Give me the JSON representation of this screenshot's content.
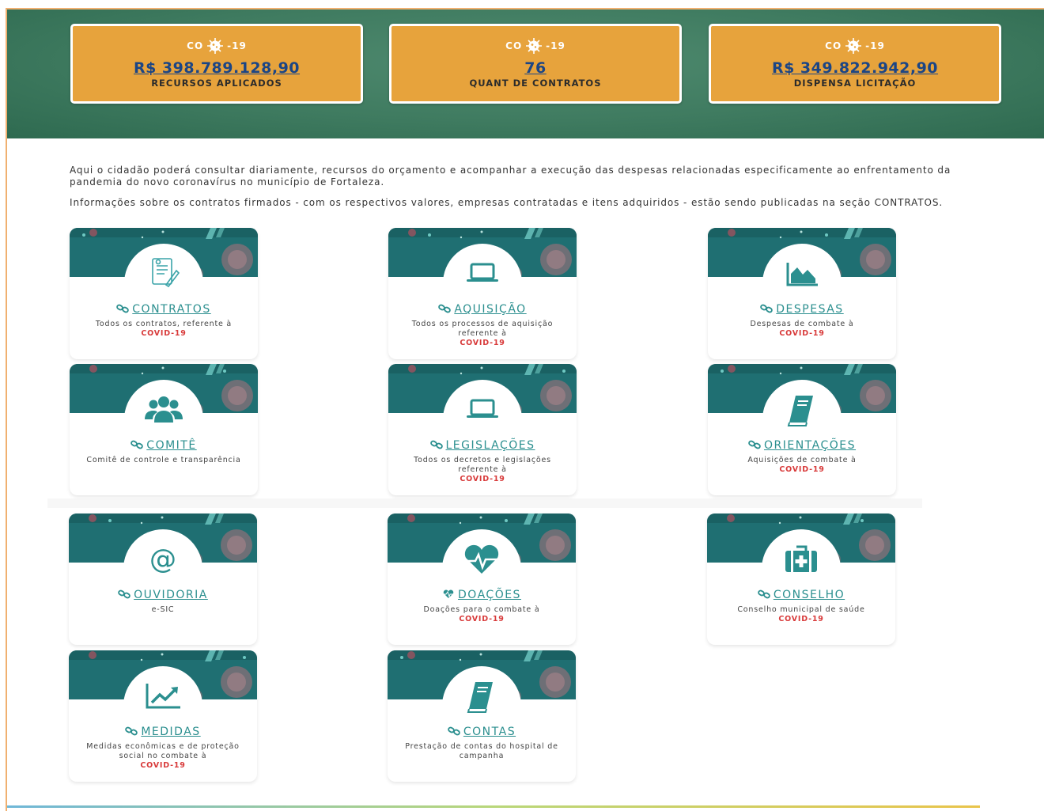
{
  "stats": [
    {
      "logo": "COVID-19",
      "value": "R$ 398.789.128,90",
      "label": "RECURSOS APLICADOS"
    },
    {
      "logo": "COVID-19",
      "value": "76",
      "label": "QUANT DE CONTRATOS"
    },
    {
      "logo": "COVID-19",
      "value": "R$ 349.822.942,90",
      "label": "DISPENSA LICITAÇÃO"
    }
  ],
  "intro": [
    "Aqui o cidadão poderá consultar diariamente, recursos do orçamento e acompanhar a execução das despesas relacionadas especificamente ao enfrentamento da pandemia do novo coronavírus no município de Fortaleza.",
    "Informações sobre os contratos firmados - com os respectivos valores, empresas contratadas e itens adquiridos - estão sendo publicadas na seção CONTRATOS."
  ],
  "cards": [
    {
      "icon": "contract-icon",
      "title": "CONTRATOS",
      "desc": "Todos os contratos, referente à",
      "highlight": "COVID-19"
    },
    {
      "icon": "laptop-icon",
      "title": "AQUISIÇÃO",
      "desc": "Todos os processos de aquisição referente à",
      "highlight": "COVID-19"
    },
    {
      "icon": "area-chart-icon",
      "title": "DESPESAS",
      "desc": "Despesas de combate à",
      "highlight": "COVID-19"
    },
    {
      "icon": "users-icon",
      "title": "COMITÊ",
      "desc": "Comitê de controle e transparência",
      "highlight": ""
    },
    {
      "icon": "laptop-icon",
      "title": "LEGISLAÇÕES",
      "desc": "Todos os decretos e legislações referente à",
      "highlight": "COVID-19"
    },
    {
      "icon": "book-icon",
      "title": "ORIENTAÇÕES",
      "desc": "Aquisições de combate à",
      "highlight": "COVID-19"
    },
    {
      "icon": "at-icon",
      "title": "OUVIDORIA",
      "desc": "e-SIC",
      "highlight": ""
    },
    {
      "icon": "heartbeat-icon",
      "title": "DOAÇÕES",
      "desc": "Doações para o combate à",
      "highlight": "COVID-19"
    },
    {
      "icon": "medkit-icon",
      "title": "CONSELHO",
      "desc": "Conselho municipal de saúde",
      "highlight": "COVID-19"
    },
    {
      "icon": "line-chart-icon",
      "title": "MEDIDAS",
      "desc": "Medidas econômicas e de proteção social no combate à",
      "highlight": "COVID-19"
    },
    {
      "icon": "book-icon",
      "title": "CONTAS",
      "desc": "Prestação de contas do hospital de campanha",
      "highlight": ""
    }
  ],
  "colors": {
    "hero": "#3f7b60",
    "stat_card": "#e7a33c",
    "stat_value": "#1b4585",
    "teal": "#2b8f8f",
    "highlight": "#d83a3a",
    "card_banner": "#1f6f72"
  }
}
